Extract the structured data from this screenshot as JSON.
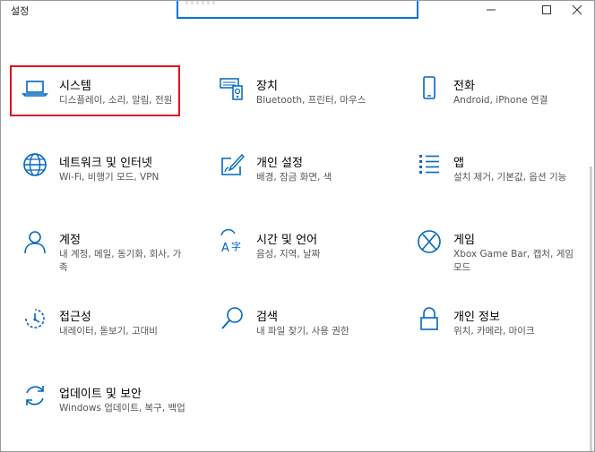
{
  "window": {
    "title": "설정"
  },
  "controls": {
    "minimize": "minimize-icon",
    "maximize": "maximize-icon",
    "close": "close-icon"
  },
  "colors": {
    "accent": "#0078d4",
    "highlight": "#e0121b"
  },
  "categories": [
    {
      "id": "system",
      "name": "시스템",
      "desc": "디스플레이, 소리, 알림, 전원",
      "icon": "laptop-icon"
    },
    {
      "id": "devices",
      "name": "장치",
      "desc": "Bluetooth, 프린터, 마우스",
      "icon": "devices-icon"
    },
    {
      "id": "phone",
      "name": "전화",
      "desc": "Android, iPhone 연결",
      "icon": "phone-icon"
    },
    {
      "id": "network",
      "name": "네트워크 및 인터넷",
      "desc": "Wi-Fi, 비행기 모드, VPN",
      "icon": "globe-icon"
    },
    {
      "id": "personalization",
      "name": "개인 설정",
      "desc": "배경, 잠금 화면, 색",
      "icon": "paint-icon"
    },
    {
      "id": "apps",
      "name": "앱",
      "desc": "설치 제거, 기본값, 옵션 기능",
      "icon": "apps-list-icon"
    },
    {
      "id": "accounts",
      "name": "계정",
      "desc": "내 계정, 메일, 동기화, 회사, 가족",
      "icon": "person-icon"
    },
    {
      "id": "time-language",
      "name": "시간 및 언어",
      "desc": "음성, 지역, 날짜",
      "icon": "language-icon"
    },
    {
      "id": "gaming",
      "name": "게임",
      "desc": "Xbox Game Bar, 캡처, 게임 모드",
      "icon": "xbox-icon"
    },
    {
      "id": "ease-of-access",
      "name": "접근성",
      "desc": "내레이터, 돋보기, 고대비",
      "icon": "accessibility-icon"
    },
    {
      "id": "search",
      "name": "검색",
      "desc": "내 파일 찾기, 사용 권한",
      "icon": "search-icon"
    },
    {
      "id": "privacy",
      "name": "개인 정보",
      "desc": "위치, 카메라, 마이크",
      "icon": "lock-icon"
    },
    {
      "id": "update-security",
      "name": "업데이트 및 보안",
      "desc": "Windows 업데이트, 복구, 백업",
      "icon": "update-icon"
    }
  ]
}
